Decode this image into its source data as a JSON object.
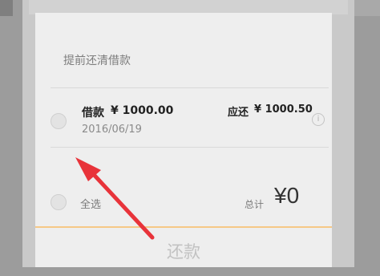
{
  "section_title": "提前还清借款",
  "loan": {
    "label": "借款",
    "amount": "¥ 1000.00",
    "date": "2016/06/19",
    "due_label": "应还",
    "due_amount": "¥ 1000.50",
    "info_icon": "info-icon",
    "info_glyph": "i"
  },
  "footer": {
    "select_all_label": "全选",
    "total_label": "总计",
    "total_value": "¥0"
  },
  "repay_button_label": "还款",
  "colors": {
    "accent_line": "#f6c886",
    "annotation_arrow": "#e8333a"
  }
}
